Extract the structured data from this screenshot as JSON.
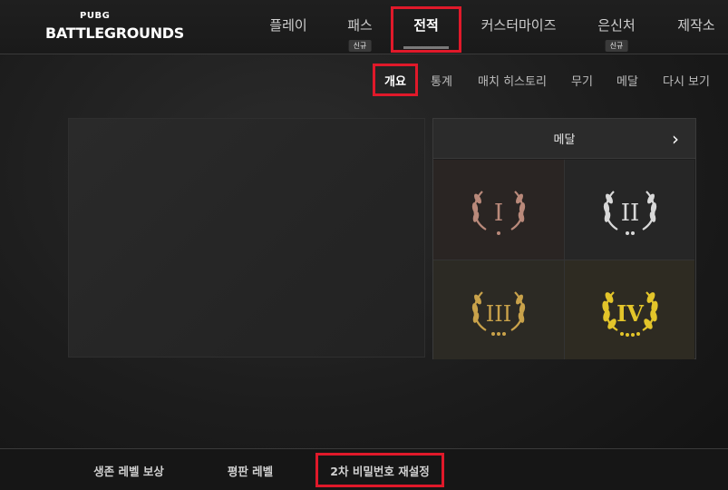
{
  "logo": {
    "small": "PUBG",
    "big": "BATTLEGROUNDS"
  },
  "nav": [
    {
      "label": "플레이",
      "badge": ""
    },
    {
      "label": "패스",
      "badge": "신규"
    },
    {
      "label": "전적",
      "badge": ""
    },
    {
      "label": "커스터마이즈",
      "badge": ""
    },
    {
      "label": "은신처",
      "badge": "신규"
    },
    {
      "label": "제작소",
      "badge": ""
    }
  ],
  "subnav": [
    "개요",
    "통계",
    "매치 히스토리",
    "무기",
    "메달",
    "다시 보기"
  ],
  "medals": {
    "title": "메달",
    "arrow": "›",
    "items": [
      {
        "numeral": "I",
        "color": "#b9897a"
      },
      {
        "numeral": "II",
        "color": "#d8d8d8"
      },
      {
        "numeral": "III",
        "color": "#c9a24a"
      },
      {
        "numeral": "IV",
        "color": "#e3c52a"
      }
    ]
  },
  "bottom": [
    "생존 레벨 보상",
    "평판 레벨",
    "2차 비밀번호 재설정"
  ]
}
